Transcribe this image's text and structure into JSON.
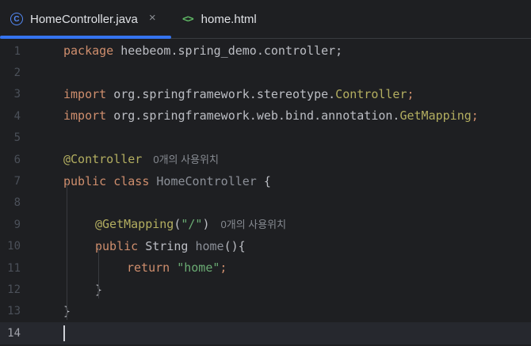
{
  "tabs": [
    {
      "label": "HomeController.java",
      "icon": "class-icon",
      "icon_glyph": "C",
      "active": true,
      "close_glyph": "×"
    },
    {
      "label": "home.html",
      "icon": "html-icon",
      "icon_glyph": "<>",
      "active": false
    }
  ],
  "editor": {
    "current_line": 14,
    "line_numbers": [
      "1",
      "2",
      "3",
      "4",
      "5",
      "6",
      "7",
      "8",
      "9",
      "10",
      "11",
      "12",
      "13",
      "14"
    ],
    "lines": {
      "l1": {
        "kw": "package",
        "rest": " heebeom.spring_demo.controller;"
      },
      "l3": {
        "kw": "import",
        "pkg": " org.springframework.stereotype.",
        "cls": "Controller",
        "end": ";"
      },
      "l4": {
        "kw": "import",
        "pkg": " org.springframework.web.bind.annotation.",
        "cls": "GetMapping",
        "end": ";"
      },
      "l6": {
        "ann": "@Controller",
        "hint": "0개의 사용위치"
      },
      "l7": {
        "kw1": "public",
        "kw2": "class",
        "name": "HomeController",
        "brace": " {"
      },
      "l9": {
        "ann": "@GetMapping",
        "open": "(",
        "str": "\"/\"",
        "close": ")",
        "hint": "0개의 사용위치"
      },
      "l10": {
        "kw": "public",
        "type": " String ",
        "method": "home",
        "rest": "(){"
      },
      "l11": {
        "kw": "return",
        "str": "\"home\"",
        "end": ";"
      },
      "l12": {
        "text": "}"
      },
      "l13": {
        "text": "}"
      }
    }
  },
  "colors": {
    "background": "#1e1f22",
    "accent": "#3574f0",
    "keyword": "#cf8e6d",
    "annotation": "#b3ae60",
    "string": "#6aab73"
  }
}
